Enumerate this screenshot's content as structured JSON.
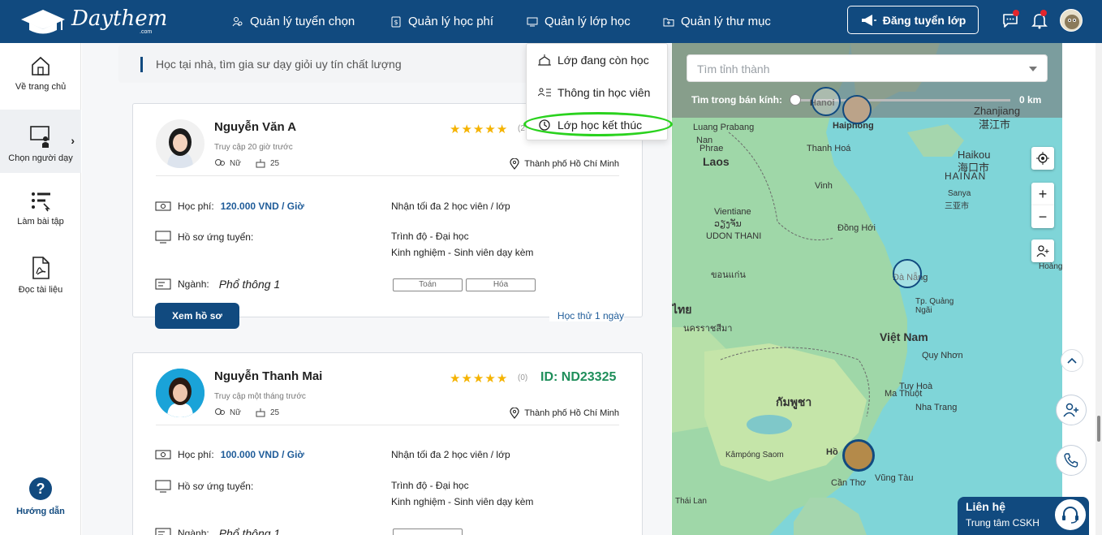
{
  "brand": {
    "name": "Daythem",
    "suffix": ".com"
  },
  "nav": {
    "items": [
      {
        "label": "Quản lý tuyển chọn",
        "icon": "people-search-icon"
      },
      {
        "label": "Quản lý học phí",
        "icon": "money-icon"
      },
      {
        "label": "Quản lý lớp học",
        "icon": "classroom-icon"
      },
      {
        "label": "Quản lý thư mục",
        "icon": "folder-icon"
      }
    ],
    "post_button": "Đăng tuyển lớp"
  },
  "dropdown": {
    "items": [
      {
        "label": "Lớp đang còn học",
        "icon": "school-icon"
      },
      {
        "label": "Thông tin học viên",
        "icon": "student-list-icon"
      },
      {
        "label": "Lớp học kết thúc",
        "icon": "clock-icon"
      }
    ]
  },
  "sidebar": {
    "items": [
      {
        "label": "Về trang chủ",
        "icon": "home-icon"
      },
      {
        "label": "Chọn người dạy",
        "icon": "teacher-icon"
      },
      {
        "label": "Làm bài tập",
        "icon": "exercise-icon"
      },
      {
        "label": "Đọc tài liệu",
        "icon": "pdf-icon"
      }
    ],
    "help": "Hướng dẫn"
  },
  "search": {
    "text": "Học tại nhà, tìm gia sư dạy giỏi uy tín chất lượng"
  },
  "tutors": [
    {
      "name": "Nguyễn Văn A",
      "access": "Truy cập 20 giờ trước",
      "gender": "Nữ",
      "age": "25",
      "rating_count": "(2",
      "id": "",
      "location": "Thành phố Hồ Chí Minh",
      "fee_label": "Học phí:",
      "fee": "120.000 VND / Giờ",
      "capacity": "Nhận tối đa 2 học viên / lớp",
      "profile_label": "Hồ sơ ứng tuyển:",
      "level": "Trình độ - Đại học",
      "experience": "Kinh nghiệm - Sinh viên dạy kèm",
      "major_label": "Ngành:",
      "major": "Phổ thông 1",
      "subjects": [
        "Toán",
        "Hóa"
      ],
      "view_button": "Xem hồ sơ",
      "trial": "Học thử 1 ngày"
    },
    {
      "name": "Nguyễn Thanh Mai",
      "access": "Truy cập một tháng trước",
      "gender": "Nữ",
      "age": "25",
      "rating_count": "(0)",
      "id": "ID: ND23325",
      "location": "Thành phố Hồ Chí Minh",
      "fee_label": "Học phí:",
      "fee": "100.000 VND / Giờ",
      "capacity": "Nhận tối đa 2 học viên / lớp",
      "profile_label": "Hồ sơ ứng tuyển:",
      "level": "Trình độ - Đại học",
      "experience": "Kinh nghiệm - Sinh viên dạy kèm",
      "major_label": "Ngành:",
      "major": "Phổ thông 1"
    }
  ],
  "map": {
    "province_placeholder": "Tìm tỉnh thành",
    "radius_label": "Tìm trong bán kính:",
    "radius_value": "0 km",
    "zoom_in": "+",
    "zoom_out": "−",
    "places": [
      "Laos",
      "Việt Nam",
      "Vientiane",
      "ວຽງຈັນ",
      "UDON THANI",
      "Haiphong",
      "Thanh Hoá",
      "Vinh",
      "Đồng Hới",
      "Đà Nẵng",
      "Tp. Quảng Ngãi",
      "Quy Nhơn",
      "Tuy Hoà",
      "Nha Trang",
      "Ma Thuột",
      "Cần Thơ",
      "Vũng Tàu",
      "Zhanjiang",
      "湛江市",
      "Haikou",
      "海口市",
      "HAINAN",
      "Sanya",
      "三亚市",
      "Luang Prabang",
      "Nan",
      "Phrae",
      "Hoàng",
      "ไทย",
      "กัมพูชา",
      "ขอนแก่น",
      "นครราชสีมา",
      "Kâmpóng Saom",
      "Thái Lan",
      "Hồ",
      "Hanoi"
    ]
  },
  "support": {
    "title": "Liên hệ",
    "subtitle": "Trung tâm CSKH"
  }
}
